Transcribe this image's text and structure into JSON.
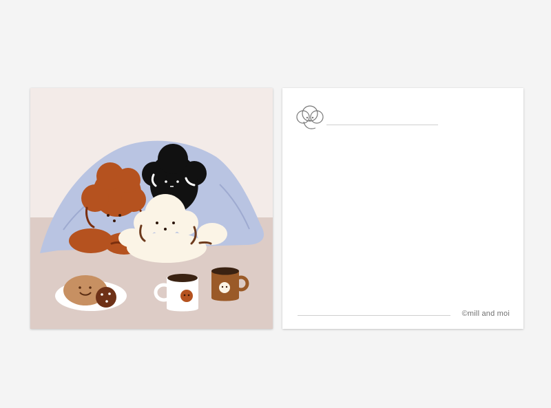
{
  "back": {
    "brand_text": "©mill and moi"
  },
  "icons": {
    "logo": "poodle-face-icon"
  },
  "colors": {
    "background": "#f4f4f4",
    "front_wall": "#f3ebe8",
    "front_floor": "#ddccc6",
    "blanket": "#b9c4e2",
    "brown_dog": "#b5521f",
    "black_dog": "#111111",
    "white_dog": "#fbf4e6",
    "cookie": "#c79062",
    "mug_brown": "#9a5a28"
  }
}
